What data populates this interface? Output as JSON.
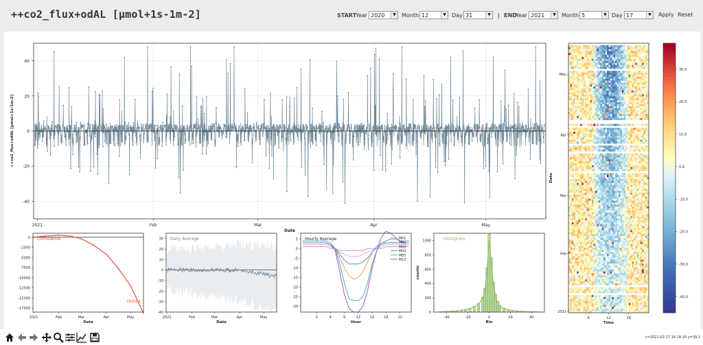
{
  "page": {
    "title": "++co2_flux+odAL [µmol+1s-1m-2]"
  },
  "controls": {
    "start_label": "START",
    "end_label": "END",
    "year_label": "Year",
    "month_label": "Month",
    "day_label": "Day",
    "separator": "|",
    "start": {
      "year": "2020",
      "month": "12",
      "day": "31"
    },
    "end": {
      "year": "2021",
      "month": "5",
      "day": "17"
    },
    "apply_label": "Apply",
    "reset_label": "Reset"
  },
  "toolbar": {
    "icons": [
      "home-icon",
      "back-arrow-icon",
      "forward-arrow-icon",
      "pan-icon",
      "zoom-icon",
      "configure-subplots-icon",
      "edit-axis-icon",
      "save-icon"
    ],
    "coordinates": "x=2021-02-27 16:18:16 y=39.2"
  },
  "chart_data": [
    {
      "type": "line",
      "id": "timeseries",
      "xlabel": "Date",
      "ylabel": "++co2_flux+odAL [µmol+1s-1m-2]",
      "ylim": [
        -50,
        50
      ],
      "yticks": [
        -40,
        -20,
        0,
        20,
        40
      ],
      "xlim": [
        "2020-12-31",
        "2021-05-17"
      ],
      "xticks": [
        {
          "date": "2021-01-01",
          "label": "2021"
        },
        {
          "date": "2021-02-01",
          "label": "Feb"
        },
        {
          "date": "2021-03-01",
          "label": "Mar"
        },
        {
          "date": "2021-04-01",
          "label": "Apr"
        },
        {
          "date": "2021-05-01",
          "label": "May"
        }
      ],
      "series_color": "#6f8898",
      "zero_line": true,
      "note": "half-hourly flux values fluctuating around 0 with spikes between about -48 and 48"
    },
    {
      "type": "line",
      "id": "cumulative",
      "legend": "Cumulative",
      "color": "#e8523a",
      "ylim": [
        -18500,
        1000
      ],
      "yticks": [
        0,
        -2500,
        -5000,
        -7500,
        -10000,
        -12500,
        -15000,
        -17500
      ],
      "xlabel": "Date",
      "xticks": [
        "2021",
        "Feb",
        "Mar",
        "Apr",
        "May"
      ],
      "points": [
        [
          "2021-01-01",
          0
        ],
        [
          "2021-01-15",
          300
        ],
        [
          "2021-02-01",
          500
        ],
        [
          "2021-02-15",
          300
        ],
        [
          "2021-03-01",
          -400
        ],
        [
          "2021-03-15",
          -1800
        ],
        [
          "2021-04-01",
          -4200
        ],
        [
          "2021-04-15",
          -7500
        ],
        [
          "2021-05-01",
          -12000
        ],
        [
          "2021-05-10",
          -15800
        ],
        [
          "2021-05-17",
          -18800
        ]
      ],
      "final_label": "-19201.1"
    },
    {
      "type": "line",
      "id": "daily-average",
      "legend": "Daily Average",
      "color": "#6f8898",
      "ylim": [
        -40,
        35
      ],
      "yticks": [
        30,
        20,
        10,
        0,
        -10,
        -20,
        -30,
        -40
      ],
      "xlabel": "Date",
      "xticks": [
        "2021",
        "Feb",
        "Mar",
        "Apr",
        "May"
      ],
      "band": "min/max shaded envelope"
    },
    {
      "type": "line",
      "id": "hourly-average",
      "legend": "Hourly Average",
      "xlabel": "Hour",
      "xticks": [
        3,
        6,
        9,
        12,
        15,
        18,
        21
      ],
      "ylim": [
        -33,
        8
      ],
      "yticks": [
        5,
        0,
        -5,
        -10,
        -15,
        -20,
        -25,
        -30
      ],
      "series": [
        {
          "name": "M01",
          "color": "#e38fb7",
          "values": [
            1,
            1,
            1,
            1,
            1,
            1,
            0,
            0,
            -1,
            -1,
            -1,
            -1,
            -1,
            -1,
            0,
            0,
            0,
            0,
            1,
            1,
            1,
            1,
            1,
            1
          ]
        },
        {
          "name": "M02",
          "color": "#c7b4d9",
          "values": [
            2,
            2,
            2,
            2,
            2,
            2,
            1,
            0,
            -2,
            -3,
            -4,
            -4,
            -4,
            -3,
            -2,
            -1,
            0,
            1,
            2,
            2,
            2,
            2,
            2,
            2
          ]
        },
        {
          "name": "M03",
          "color": "#e8a04a",
          "values": [
            3,
            3,
            3,
            3,
            3,
            3,
            2,
            0,
            -5,
            -10,
            -14,
            -16,
            -15,
            -12,
            -7,
            -2,
            1,
            3,
            3,
            3,
            3,
            3,
            3,
            3
          ]
        },
        {
          "name": "M04",
          "color": "#4f8fcf",
          "values": [
            3,
            3,
            3,
            3,
            3,
            3,
            2,
            0,
            -3,
            -6,
            -8,
            -8,
            -8,
            -7,
            -5,
            -2,
            1,
            2,
            3,
            3,
            3,
            3,
            3,
            3
          ]
        },
        {
          "name": "M05",
          "color": "#4ab59f",
          "values": [
            4,
            4,
            4,
            4,
            4,
            4,
            3,
            0,
            -8,
            -18,
            -26,
            -27,
            -27,
            -25,
            -18,
            -8,
            -1,
            3,
            4,
            5,
            5,
            4,
            4,
            4
          ]
        },
        {
          "name": "M12",
          "color": "#a455c4",
          "values": [
            3,
            3,
            3,
            3,
            3,
            3,
            2,
            -1,
            -12,
            -24,
            -31,
            -33,
            -33,
            -30,
            -22,
            -10,
            -1,
            6,
            9,
            8,
            6,
            4,
            3,
            3
          ]
        }
      ]
    },
    {
      "type": "bar",
      "id": "histogram",
      "legend": "Histogram",
      "color": "#8bbb60",
      "xlabel": "Bin",
      "ylabel": "counts",
      "ylim": [
        0,
        1100
      ],
      "yticks": [
        0,
        200,
        400,
        600,
        800,
        1000
      ],
      "xticks": [
        -40,
        -20,
        0,
        20,
        40
      ],
      "bins": [
        [
          -46,
          5
        ],
        [
          -42,
          8
        ],
        [
          -38,
          10
        ],
        [
          -34,
          15
        ],
        [
          -30,
          20
        ],
        [
          -26,
          28
        ],
        [
          -22,
          38
        ],
        [
          -18,
          55
        ],
        [
          -14,
          80
        ],
        [
          -10,
          120
        ],
        [
          -6,
          210
        ],
        [
          -4,
          330
        ],
        [
          -2,
          620
        ],
        [
          0,
          1090
        ],
        [
          2,
          760
        ],
        [
          4,
          420
        ],
        [
          6,
          250
        ],
        [
          8,
          150
        ],
        [
          10,
          90
        ],
        [
          14,
          55
        ],
        [
          18,
          35
        ],
        [
          22,
          25
        ],
        [
          26,
          18
        ],
        [
          30,
          12
        ],
        [
          34,
          8
        ],
        [
          38,
          6
        ],
        [
          42,
          4
        ],
        [
          46,
          3
        ]
      ]
    },
    {
      "type": "heatmap",
      "id": "fingerprint",
      "xlabel": "Time",
      "ylabel": "Date",
      "xticks": [
        6,
        12,
        18
      ],
      "yticks": [
        "2021",
        "Feb",
        "Mar",
        "Apr",
        "May"
      ],
      "colorbar": {
        "ticks": [
          30.0,
          20.0,
          10.0,
          0.0,
          -10.0,
          -20.0,
          -30.0,
          -40.0
        ],
        "range": [
          -45,
          38
        ],
        "colormap": "RdYlBu_r"
      }
    }
  ]
}
